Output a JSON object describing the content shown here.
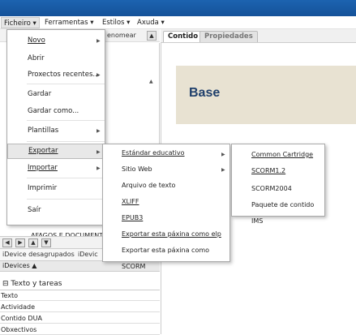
{
  "menubar": {
    "items": [
      {
        "label": "Ficheiro ▾"
      },
      {
        "label": "Ferramentas ▾"
      },
      {
        "label": "Estilos ▾"
      },
      {
        "label": "Axuda ▾"
      }
    ]
  },
  "left": {
    "renomear": "enomear",
    "afagos": "AFAGOS E DOCUMENTOS",
    "tabs": [
      "iDevice desagrupados",
      "iDevic"
    ],
    "idevices_header": "iDevices ▲",
    "category": "⊟ Texto y tareas",
    "items": [
      "Texto",
      "Actividade",
      "Contido DUA",
      "Obxectivos"
    ]
  },
  "content": {
    "tabs": [
      "Contido",
      "Propiedades"
    ],
    "banner_title": "Base"
  },
  "file_menu": {
    "items": [
      {
        "label": "Novo",
        "submenu": true
      },
      {
        "label": "Abrir",
        "submenu": false
      },
      {
        "label": "Proxectos recentes...",
        "submenu": true
      },
      {
        "label": "Gardar",
        "submenu": false
      },
      {
        "label": "Gardar como...",
        "submenu": false
      },
      {
        "label": "Plantillas",
        "submenu": true
      },
      {
        "label": "Exportar",
        "submenu": true
      },
      {
        "label": "Importar",
        "submenu": true
      },
      {
        "label": "Imprimir",
        "submenu": false
      },
      {
        "label": "Saír",
        "submenu": false
      }
    ]
  },
  "export_menu": {
    "items": [
      {
        "label": "Estándar educativo",
        "submenu": true
      },
      {
        "label": "Sitio Web",
        "submenu": true
      },
      {
        "label": "Arquivo de texto",
        "submenu": false
      },
      {
        "label": "XLIFF",
        "submenu": false
      },
      {
        "label": "EPUB3",
        "submenu": false
      },
      {
        "label": "Exportar esta páxina como elp",
        "submenu": false
      },
      {
        "label": "Exportar esta páxina como SCORM",
        "submenu": false
      }
    ]
  },
  "standard_menu": {
    "items": [
      {
        "label": "Common Cartridge"
      },
      {
        "label": "SCORM1.2"
      },
      {
        "label": "SCORM2004"
      },
      {
        "label": "Paquete de contido IMS"
      }
    ]
  }
}
